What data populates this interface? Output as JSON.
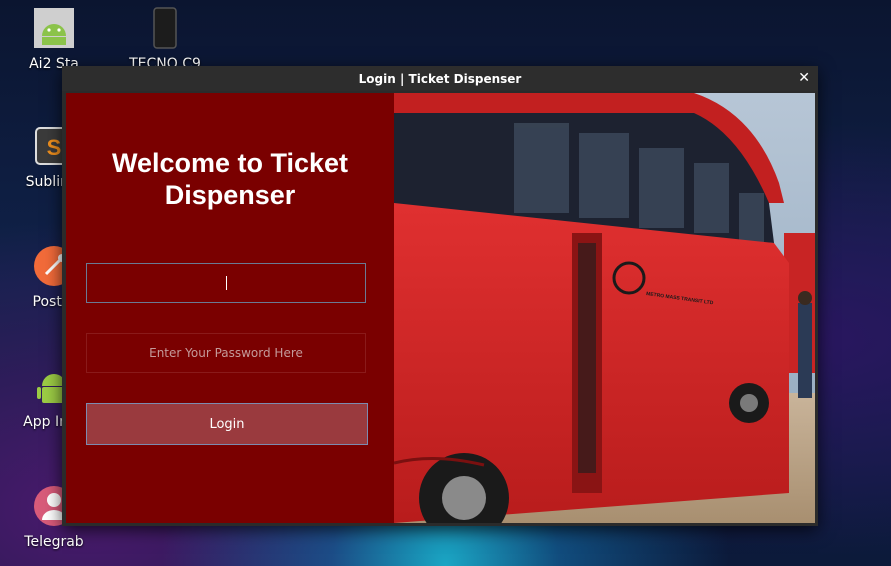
{
  "desktop": {
    "icons": [
      {
        "label": "Ai2 Sta",
        "icon": "android-icon"
      },
      {
        "label": "TECNO C9",
        "icon": "phone-icon"
      },
      {
        "label": "Sublime",
        "icon": "sublime-icon"
      },
      {
        "label": "Postm",
        "icon": "postman-icon"
      },
      {
        "label": "App Inve",
        "icon": "android-icon"
      },
      {
        "label": "Telegrab",
        "icon": "telegrab-icon"
      }
    ]
  },
  "window": {
    "title": "Login | Ticket Dispenser",
    "close_glyph": "✕"
  },
  "login": {
    "heading": "Welcome to Ticket Dispenser",
    "username_value": "",
    "password_placeholder": "Enter Your Password Here",
    "button_label": "Login"
  },
  "photo": {
    "bus_text": "METRO MASS TRANSIT LTD",
    "colors": {
      "panel": "#7a0000",
      "bus": "#d32222"
    }
  }
}
